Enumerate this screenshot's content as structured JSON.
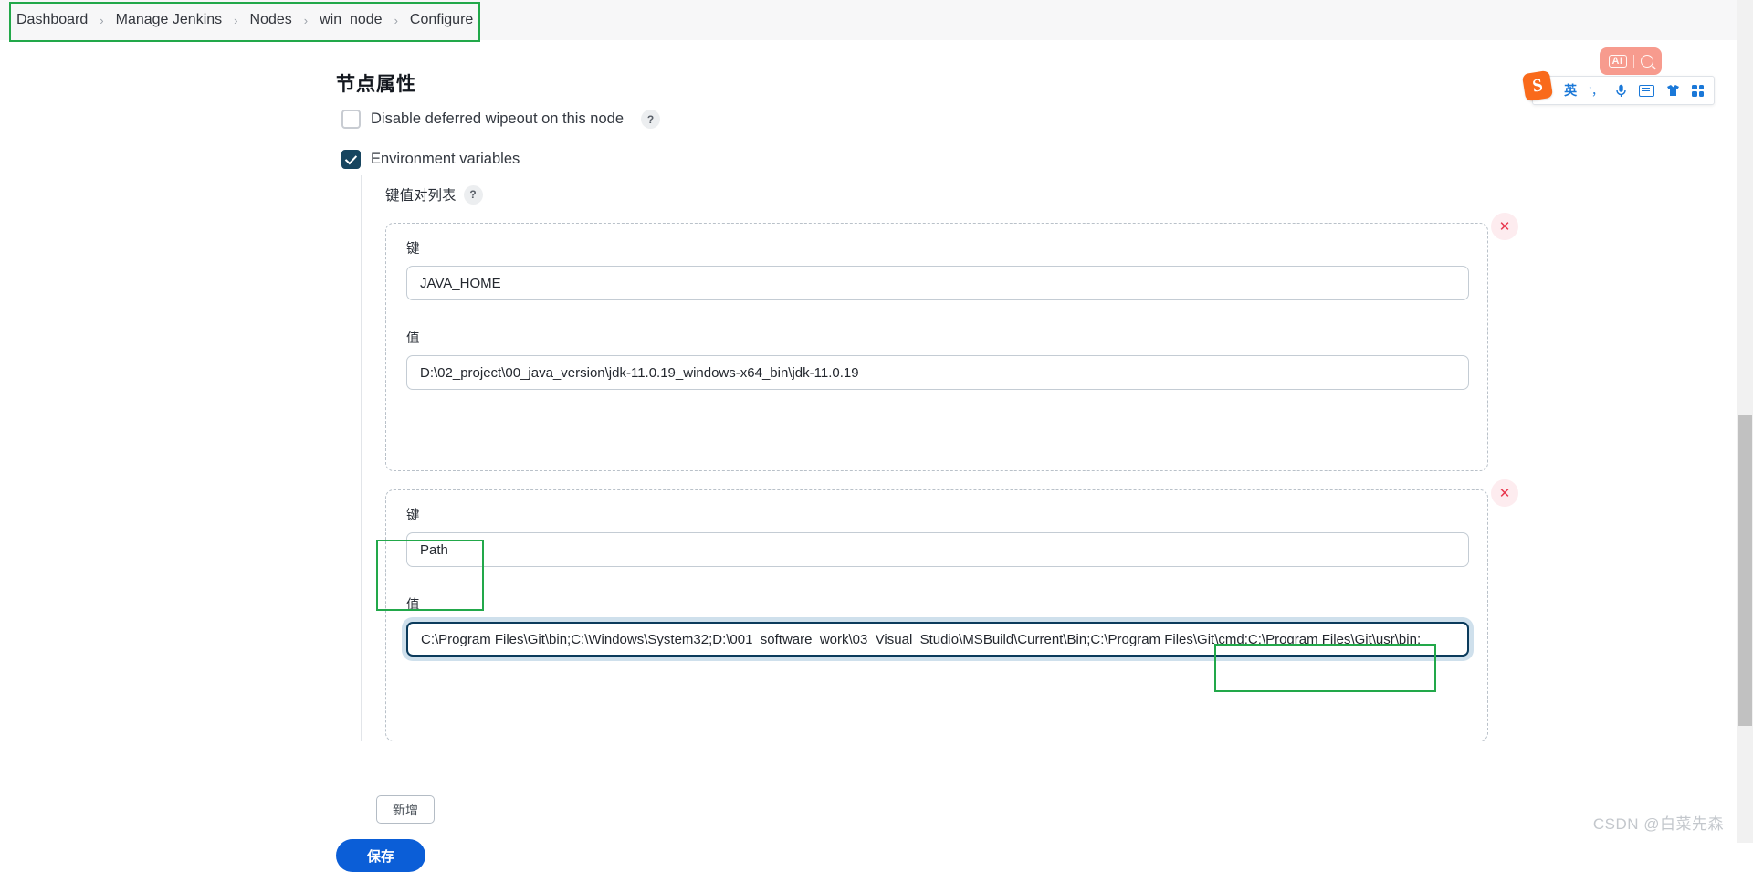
{
  "breadcrumb": {
    "items": [
      {
        "label": "Dashboard"
      },
      {
        "label": "Manage Jenkins"
      },
      {
        "label": "Nodes"
      },
      {
        "label": "win_node"
      },
      {
        "label": "Configure"
      }
    ],
    "separator": "›"
  },
  "page": {
    "title": "节点属性"
  },
  "options": {
    "disable_wipeout": {
      "label": "Disable deferred wipeout on this node",
      "checked": false,
      "help": "?"
    },
    "environment_variables": {
      "label": "Environment variables",
      "checked": true
    }
  },
  "kv_section": {
    "label": "键值对列表",
    "help": "?",
    "key_label": "键",
    "value_label": "值",
    "delete_label": "✕",
    "entries": [
      {
        "key": "JAVA_HOME",
        "value": "D:\\02_project\\00_java_version\\jdk-11.0.19_windows-x64_bin\\jdk-11.0.19"
      },
      {
        "key": "Path",
        "value": "C:\\Program Files\\Git\\bin;C:\\Windows\\System32;D:\\001_software_work\\03_Visual_Studio\\MSBuild\\Current\\Bin;C:\\Program Files\\Git\\cmd;C:\\Program Files\\Git\\usr\\bin;"
      }
    ],
    "add_button": "新增"
  },
  "footer": {
    "save_button": "保存"
  },
  "ime": {
    "ai_label": "AI",
    "logo": "S",
    "mode": "英",
    "punctuation": "’，",
    "mic": "🎙",
    "keyboard": "keyboard",
    "skin": "shirt",
    "apps": "grid"
  },
  "watermark": "CSDN @白菜先森",
  "colors": {
    "accent_green": "#22a84a",
    "save_blue": "#0b5ed7",
    "checkbox_navy": "#17455f",
    "delete_red": "#e8384f",
    "ime_orange": "#f96a1b",
    "ime_blue": "#1a78d8"
  }
}
